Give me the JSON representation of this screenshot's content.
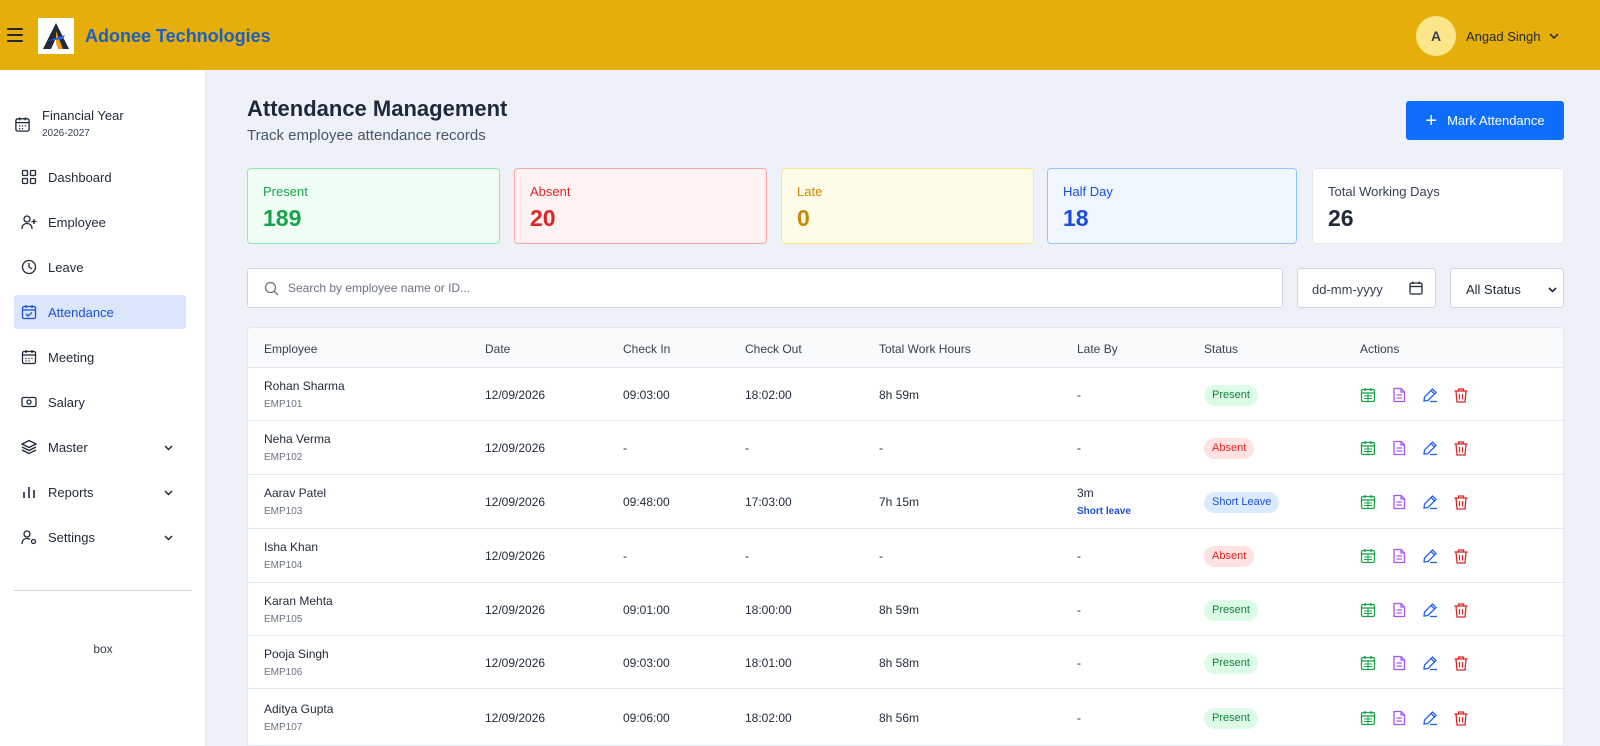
{
  "header": {
    "brand": "Adonee Technologies",
    "user": {
      "initial": "A",
      "name": "Angad Singh"
    }
  },
  "sidebar": {
    "financial_year": {
      "title": "Financial Year",
      "years": "2026-2027"
    },
    "items": [
      {
        "label": "Dashboard",
        "icon": "grid-icon"
      },
      {
        "label": "Employee",
        "icon": "user-plus-icon"
      },
      {
        "label": "Leave",
        "icon": "clock-icon"
      },
      {
        "label": "Attendance",
        "icon": "calendar-check-icon",
        "active": true
      },
      {
        "label": "Meeting",
        "icon": "calendar-icon"
      },
      {
        "label": "Salary",
        "icon": "money-icon"
      },
      {
        "label": "Master",
        "icon": "layers-icon",
        "expandable": true
      },
      {
        "label": "Reports",
        "icon": "bar-chart-icon",
        "expandable": true
      },
      {
        "label": "Settings",
        "icon": "user-settings-icon",
        "expandable": true
      }
    ],
    "footer": "box"
  },
  "main": {
    "title": "Attendance Management",
    "subtitle": "Track employee attendance records",
    "mark_button": "Mark Attendance",
    "stats": [
      {
        "label": "Present",
        "value": "189",
        "color": "#16a34a",
        "bg": "#f0fdf4",
        "border": "#86efac"
      },
      {
        "label": "Absent",
        "value": "20",
        "color": "#dc2626",
        "bg": "#fef2f2",
        "border": "#fca5a5"
      },
      {
        "label": "Late",
        "value": "0",
        "color": "#ca8a04",
        "bg": "#fefce8",
        "border": "#fde68a"
      },
      {
        "label": "Half Day",
        "value": "18",
        "color": "#1d4ed8",
        "bg": "#eff6ff",
        "border": "#93c5fd"
      },
      {
        "label": "Total Working Days",
        "value": "26",
        "color": "#1e293b",
        "bg": "#ffffff",
        "border": "#e2e8f0"
      }
    ],
    "search": {
      "placeholder": "Search by employee name or ID..."
    },
    "date_filter": "dd-mm-yyyy",
    "status_filter": "All Status",
    "table": {
      "headers": [
        "Employee",
        "Date",
        "Check In",
        "Check Out",
        "Total Work Hours",
        "Late By",
        "Status",
        "Actions"
      ],
      "rows": [
        {
          "name": "Rohan Sharma",
          "id": "EMP101",
          "date": "12/09/2026",
          "check_in": "09:03:00",
          "check_out": "18:02:00",
          "hours": "8h 59m",
          "late": "-",
          "late_note": "",
          "status": "Present"
        },
        {
          "name": "Neha Verma",
          "id": "EMP102",
          "date": "12/09/2026",
          "check_in": "-",
          "check_out": "-",
          "hours": "-",
          "late": "-",
          "late_note": "",
          "status": "Absent"
        },
        {
          "name": "Aarav Patel",
          "id": "EMP103",
          "date": "12/09/2026",
          "check_in": "09:48:00",
          "check_out": "17:03:00",
          "hours": "7h 15m",
          "late": "3m",
          "late_note": "Short leave",
          "status": "Short Leave"
        },
        {
          "name": "Isha Khan",
          "id": "EMP104",
          "date": "12/09/2026",
          "check_in": "-",
          "check_out": "-",
          "hours": "-",
          "late": "-",
          "late_note": "",
          "status": "Absent"
        },
        {
          "name": "Karan Mehta",
          "id": "EMP105",
          "date": "12/09/2026",
          "check_in": "09:01:00",
          "check_out": "18:00:00",
          "hours": "8h 59m",
          "late": "-",
          "late_note": "",
          "status": "Present"
        },
        {
          "name": "Pooja Singh",
          "id": "EMP106",
          "date": "12/09/2026",
          "check_in": "09:03:00",
          "check_out": "18:01:00",
          "hours": "8h 58m",
          "late": "-",
          "late_note": "",
          "status": "Present"
        },
        {
          "name": "Aditya Gupta",
          "id": "EMP107",
          "date": "12/09/2026",
          "check_in": "09:06:00",
          "check_out": "18:02:00",
          "hours": "8h 56m",
          "late": "-",
          "late_note": "",
          "status": "Present"
        }
      ]
    },
    "status_styles": {
      "Present": {
        "bg": "#dcfce7",
        "fg": "#15803d"
      },
      "Absent": {
        "bg": "#fee2e2",
        "fg": "#dc2626"
      },
      "Short Leave": {
        "bg": "#dbeafe",
        "fg": "#1d4ed8"
      }
    },
    "action_icons": [
      {
        "name": "calendar-action-icon",
        "color": "#16a34a"
      },
      {
        "name": "document-action-icon",
        "color": "#a855f7"
      },
      {
        "name": "edit-action-icon",
        "color": "#2563eb"
      },
      {
        "name": "delete-action-icon",
        "color": "#dc2626"
      }
    ]
  }
}
